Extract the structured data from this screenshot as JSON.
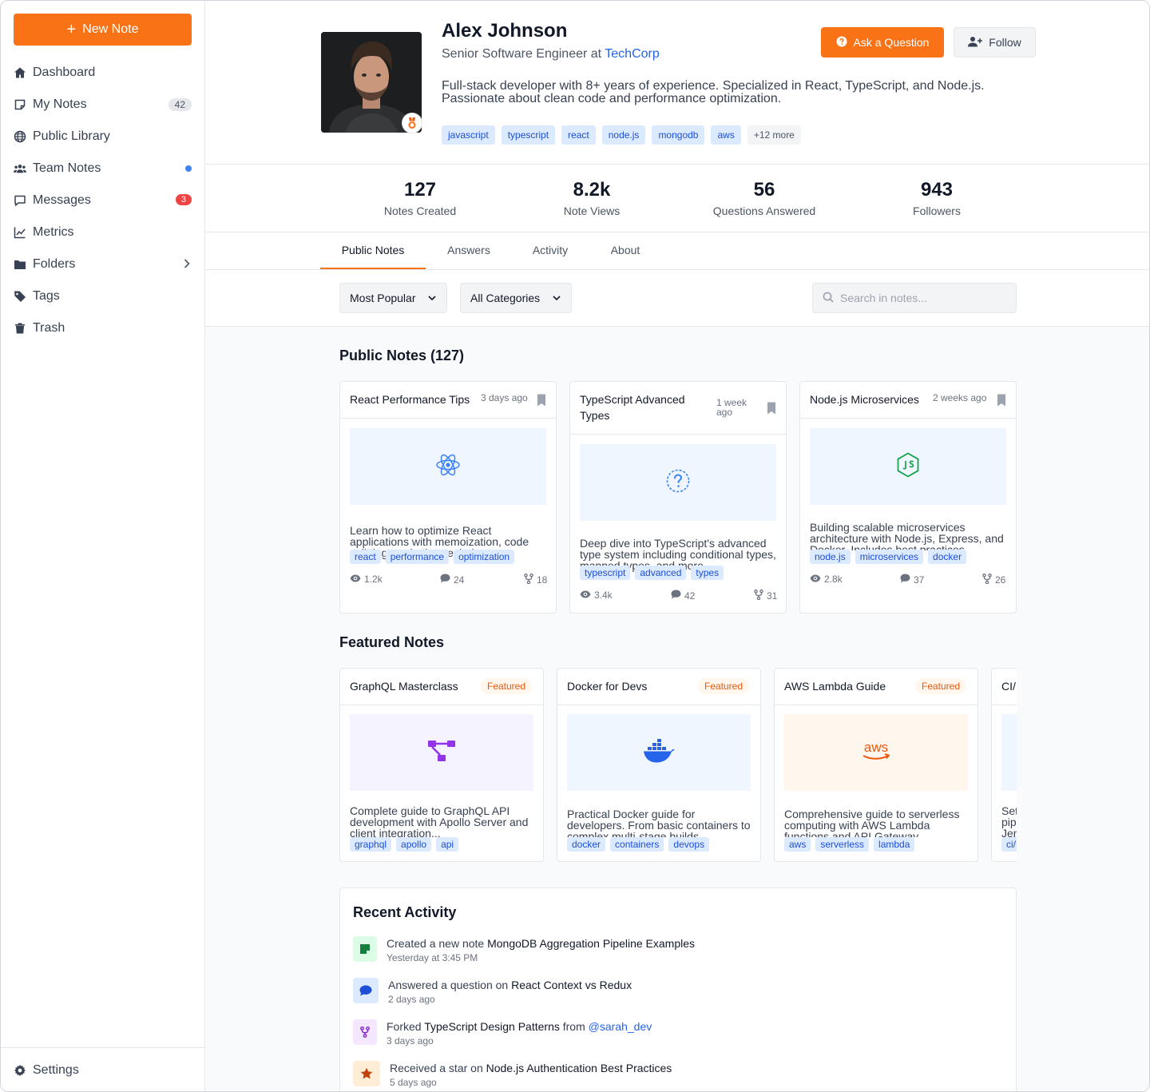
{
  "sidebar": {
    "new_note_label": "New Note",
    "items": [
      {
        "label": "Dashboard",
        "icon": "home-icon"
      },
      {
        "label": "My Notes",
        "icon": "note-icon",
        "badge": "42"
      },
      {
        "label": "Public Library",
        "icon": "globe-icon"
      },
      {
        "label": "Team Notes",
        "icon": "users-icon"
      },
      {
        "label": "Messages",
        "icon": "message-icon",
        "badge": "3"
      },
      {
        "label": "Metrics",
        "icon": "chart-line-icon"
      },
      {
        "label": "Folders",
        "icon": "folder-icon"
      },
      {
        "label": "Tags",
        "icon": "tag-icon"
      },
      {
        "label": "Trash",
        "icon": "trash-icon"
      }
    ],
    "settings_label": "Settings"
  },
  "profile": {
    "name": "Alex Johnson",
    "role_prefix": "Senior Software Engineer at",
    "company": "TechCorp",
    "bio": "Full-stack developer with 8+ years of experience. Specialized in React, TypeScript, and Node.js. Passionate about clean code and performance optimization.",
    "tags": [
      "javascript",
      "typescript",
      "react",
      "node.js",
      "mongodb",
      "aws"
    ],
    "more_tags": "+12 more",
    "ask_label": "Ask a Question",
    "follow_label": "Follow"
  },
  "stats": [
    {
      "value": "127",
      "label": "Notes Created"
    },
    {
      "value": "8.2k",
      "label": "Note Views"
    },
    {
      "value": "56",
      "label": "Questions Answered"
    },
    {
      "value": "943",
      "label": "Followers"
    }
  ],
  "tabs": [
    "Public Notes",
    "Answers",
    "Activity",
    "About"
  ],
  "filters": {
    "sort": "Most Popular",
    "category": "All Categories",
    "search_placeholder": "Search in notes..."
  },
  "public_notes": {
    "title": "Public Notes (127)",
    "cards": [
      {
        "title": "React Performance Tips",
        "time": "3 days ago",
        "desc": "Learn how to optimize React applications with memoization, code splitting, and other techniques...",
        "tags": [
          "react",
          "performance",
          "optimization"
        ],
        "views": "1.2k",
        "comments": "24",
        "forks": "18",
        "icon": "react-icon"
      },
      {
        "title": "TypeScript Advanced Types",
        "time": "1 week ago",
        "desc": "Deep dive into TypeScript's advanced type system including conditional types, mapped types, and more...",
        "tags": [
          "typescript",
          "advanced",
          "types"
        ],
        "views": "3.4k",
        "comments": "42",
        "forks": "31",
        "icon": "question-icon"
      },
      {
        "title": "Node.js Microservices",
        "time": "2 weeks ago",
        "desc": "Building scalable microservices architecture with Node.js, Express, and Docker. Includes best practices...",
        "tags": [
          "node.js",
          "microservices",
          "docker"
        ],
        "views": "2.8k",
        "comments": "37",
        "forks": "26",
        "icon": "nodejs-icon"
      }
    ]
  },
  "featured_notes": {
    "title": "Featured Notes",
    "badge": "Featured",
    "cards": [
      {
        "title": "GraphQL Masterclass",
        "desc": "Complete guide to GraphQL API development with Apollo Server and client integration...",
        "tags": [
          "graphql",
          "apollo",
          "api"
        ],
        "icon": "graph-icon"
      },
      {
        "title": "Docker for Devs",
        "desc": "Practical Docker guide for developers. From basic containers to complex multi-stage builds...",
        "tags": [
          "docker",
          "containers",
          "devops"
        ],
        "icon": "docker-icon"
      },
      {
        "title": "AWS Lambda Guide",
        "desc": "Comprehensive guide to serverless computing with AWS Lambda functions and API Gateway...",
        "tags": [
          "aws",
          "serverless",
          "lambda"
        ],
        "icon": "aws-icon"
      },
      {
        "title": "CI/",
        "desc": "Set pip Jen",
        "tags": [
          "ci/"
        ],
        "icon": "pipeline-icon"
      }
    ]
  },
  "activity": {
    "title": "Recent Activity",
    "items": [
      {
        "prefix": "Created a new note",
        "subject": "MongoDB Aggregation Pipeline Examples",
        "time": "Yesterday at 3:45 PM",
        "icon": "note-add-icon"
      },
      {
        "prefix": "Answered a question on",
        "subject": "React Context vs Redux",
        "time": "2 days ago",
        "icon": "comment-icon"
      },
      {
        "prefix": "Forked",
        "subject": "TypeScript Design Patterns",
        "mid": "from",
        "user": "@sarah_dev",
        "time": "3 days ago",
        "icon": "fork-icon"
      },
      {
        "prefix": "Received a star on",
        "subject": "Node.js Authentication Best Practices",
        "time": "5 days ago",
        "icon": "star-icon"
      }
    ]
  },
  "colors": {
    "accent": "#f97316",
    "link": "#2563eb",
    "tag_bg": "#dbeafe",
    "tag_text": "#1d4ed8"
  }
}
